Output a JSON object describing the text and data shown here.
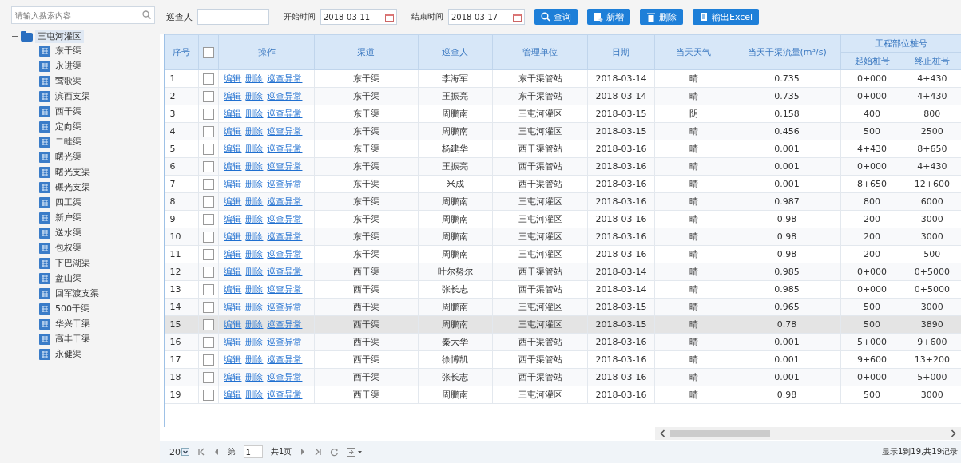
{
  "sidebar": {
    "search": {
      "placeholder": "请输入搜索内容"
    },
    "tree": {
      "label": "三屯河灌区",
      "expanded": true,
      "selected": true,
      "children": [
        {
          "label": "东干渠",
          "selected": false
        },
        {
          "label": "永进渠",
          "selected": false
        },
        {
          "label": "莺歌渠",
          "selected": false
        },
        {
          "label": "滨西支渠",
          "selected": false
        },
        {
          "label": "西干渠",
          "selected": false
        },
        {
          "label": "定向渠",
          "selected": false
        },
        {
          "label": "二畦渠",
          "selected": false
        },
        {
          "label": "曙光渠",
          "selected": false
        },
        {
          "label": "曙光支渠",
          "selected": false
        },
        {
          "label": "碾光支渠",
          "selected": false
        },
        {
          "label": "四工渠",
          "selected": false
        },
        {
          "label": "新户渠",
          "selected": false
        },
        {
          "label": "送水渠",
          "selected": false
        },
        {
          "label": "包权渠",
          "selected": false
        },
        {
          "label": "下巴湖渠",
          "selected": false
        },
        {
          "label": "盘山渠",
          "selected": false
        },
        {
          "label": "回军渡支渠",
          "selected": false
        },
        {
          "label": "500干渠",
          "selected": false
        },
        {
          "label": "华兴干渠",
          "selected": false
        },
        {
          "label": "高丰干渠",
          "selected": false
        },
        {
          "label": "永健渠",
          "selected": false
        }
      ]
    }
  },
  "toolbar": {
    "inspector_label": "巡查人",
    "start_label": "开始时间",
    "start_value": "2018-03-11",
    "end_label": "结束时间",
    "end_value": "2018-03-17",
    "buttons": [
      {
        "label": "查询",
        "kind": "search"
      },
      {
        "label": "新增",
        "kind": "add"
      },
      {
        "label": "删除",
        "kind": "delete"
      },
      {
        "label": "输出Excel",
        "kind": "export"
      }
    ]
  },
  "table": {
    "columns": {
      "seq": "序号",
      "ops": "操作",
      "channel": "渠道",
      "inspector": "巡查人",
      "unit": "管理单位",
      "date": "日期",
      "weather": "当天天气",
      "flow": "当天干渠流量(m³/s)",
      "stake_group": "工程部位桩号",
      "start": "起始桩号",
      "end": "终止桩号"
    },
    "select_all": false,
    "rows": [
      {
        "seq": "1",
        "checked": false,
        "selected": false,
        "ops": [
          "编辑",
          "删除",
          "巡查异常"
        ],
        "channel": "东干渠",
        "inspector": "李海军",
        "unit": "东干渠管站",
        "date": "2018-03-14",
        "weather": "晴",
        "flow": "0.735",
        "start": "0+000",
        "end": "4+430"
      },
      {
        "seq": "2",
        "checked": false,
        "selected": false,
        "ops": [
          "编辑",
          "删除",
          "巡查异常"
        ],
        "channel": "东干渠",
        "inspector": "王振亮",
        "unit": "东干渠管站",
        "date": "2018-03-14",
        "weather": "晴",
        "flow": "0.735",
        "start": "0+000",
        "end": "4+430"
      },
      {
        "seq": "3",
        "checked": false,
        "selected": false,
        "ops": [
          "编辑",
          "删除",
          "巡查异常"
        ],
        "channel": "东干渠",
        "inspector": "周鹏南",
        "unit": "三屯河灌区",
        "date": "2018-03-15",
        "weather": "阴",
        "flow": "0.158",
        "start": "400",
        "end": "800"
      },
      {
        "seq": "4",
        "checked": false,
        "selected": false,
        "ops": [
          "编辑",
          "删除",
          "巡查异常"
        ],
        "channel": "东干渠",
        "inspector": "周鹏南",
        "unit": "三屯河灌区",
        "date": "2018-03-15",
        "weather": "晴",
        "flow": "0.456",
        "start": "500",
        "end": "2500"
      },
      {
        "seq": "5",
        "checked": false,
        "selected": false,
        "ops": [
          "编辑",
          "删除",
          "巡查异常"
        ],
        "channel": "东干渠",
        "inspector": "杨建华",
        "unit": "西干渠管站",
        "date": "2018-03-16",
        "weather": "晴",
        "flow": "0.001",
        "start": "4+430",
        "end": "8+650"
      },
      {
        "seq": "6",
        "checked": false,
        "selected": false,
        "ops": [
          "编辑",
          "删除",
          "巡查异常"
        ],
        "channel": "东干渠",
        "inspector": "王振亮",
        "unit": "西干渠管站",
        "date": "2018-03-16",
        "weather": "晴",
        "flow": "0.001",
        "start": "0+000",
        "end": "4+430"
      },
      {
        "seq": "7",
        "checked": false,
        "selected": false,
        "ops": [
          "编辑",
          "删除",
          "巡查异常"
        ],
        "channel": "东干渠",
        "inspector": "米成",
        "unit": "西干渠管站",
        "date": "2018-03-16",
        "weather": "晴",
        "flow": "0.001",
        "start": "8+650",
        "end": "12+600"
      },
      {
        "seq": "8",
        "checked": false,
        "selected": false,
        "ops": [
          "编辑",
          "删除",
          "巡查异常"
        ],
        "channel": "东干渠",
        "inspector": "周鹏南",
        "unit": "三屯河灌区",
        "date": "2018-03-16",
        "weather": "晴",
        "flow": "0.987",
        "start": "800",
        "end": "6000"
      },
      {
        "seq": "9",
        "checked": false,
        "selected": false,
        "ops": [
          "编辑",
          "删除",
          "巡查异常"
        ],
        "channel": "东干渠",
        "inspector": "周鹏南",
        "unit": "三屯河灌区",
        "date": "2018-03-16",
        "weather": "晴",
        "flow": "0.98",
        "start": "200",
        "end": "3000"
      },
      {
        "seq": "10",
        "checked": false,
        "selected": false,
        "ops": [
          "编辑",
          "删除",
          "巡查异常"
        ],
        "channel": "东干渠",
        "inspector": "周鹏南",
        "unit": "三屯河灌区",
        "date": "2018-03-16",
        "weather": "晴",
        "flow": "0.98",
        "start": "200",
        "end": "3000"
      },
      {
        "seq": "11",
        "checked": false,
        "selected": false,
        "ops": [
          "编辑",
          "删除",
          "巡查异常"
        ],
        "channel": "东干渠",
        "inspector": "周鹏南",
        "unit": "三屯河灌区",
        "date": "2018-03-16",
        "weather": "晴",
        "flow": "0.98",
        "start": "200",
        "end": "500"
      },
      {
        "seq": "12",
        "checked": false,
        "selected": false,
        "ops": [
          "编辑",
          "删除",
          "巡查异常"
        ],
        "channel": "西干渠",
        "inspector": "叶尔努尔",
        "unit": "西干渠管站",
        "date": "2018-03-14",
        "weather": "晴",
        "flow": "0.985",
        "start": "0+000",
        "end": "0+5000"
      },
      {
        "seq": "13",
        "checked": false,
        "selected": false,
        "ops": [
          "编辑",
          "删除",
          "巡查异常"
        ],
        "channel": "西干渠",
        "inspector": "张长志",
        "unit": "西干渠管站",
        "date": "2018-03-14",
        "weather": "晴",
        "flow": "0.985",
        "start": "0+000",
        "end": "0+5000"
      },
      {
        "seq": "14",
        "checked": false,
        "selected": false,
        "ops": [
          "编辑",
          "删除",
          "巡查异常"
        ],
        "channel": "西干渠",
        "inspector": "周鹏南",
        "unit": "三屯河灌区",
        "date": "2018-03-15",
        "weather": "晴",
        "flow": "0.965",
        "start": "500",
        "end": "3000"
      },
      {
        "seq": "15",
        "checked": false,
        "selected": true,
        "ops": [
          "编辑",
          "删除",
          "巡查异常"
        ],
        "channel": "西干渠",
        "inspector": "周鹏南",
        "unit": "三屯河灌区",
        "date": "2018-03-15",
        "weather": "晴",
        "flow": "0.78",
        "start": "500",
        "end": "3890"
      },
      {
        "seq": "16",
        "checked": false,
        "selected": false,
        "ops": [
          "编辑",
          "删除",
          "巡查异常"
        ],
        "channel": "西干渠",
        "inspector": "秦大华",
        "unit": "西干渠管站",
        "date": "2018-03-16",
        "weather": "晴",
        "flow": "0.001",
        "start": "5+000",
        "end": "9+600"
      },
      {
        "seq": "17",
        "checked": false,
        "selected": false,
        "ops": [
          "编辑",
          "删除",
          "巡查异常"
        ],
        "channel": "西干渠",
        "inspector": "徐博凯",
        "unit": "西干渠管站",
        "date": "2018-03-16",
        "weather": "晴",
        "flow": "0.001",
        "start": "9+600",
        "end": "13+200"
      },
      {
        "seq": "18",
        "checked": false,
        "selected": false,
        "ops": [
          "编辑",
          "删除",
          "巡查异常"
        ],
        "channel": "西干渠",
        "inspector": "张长志",
        "unit": "西干渠管站",
        "date": "2018-03-16",
        "weather": "晴",
        "flow": "0.001",
        "start": "0+000",
        "end": "5+000"
      },
      {
        "seq": "19",
        "checked": false,
        "selected": false,
        "ops": [
          "编辑",
          "删除",
          "巡查异常"
        ],
        "channel": "西干渠",
        "inspector": "周鹏南",
        "unit": "三屯河灌区",
        "date": "2018-03-16",
        "weather": "晴",
        "flow": "0.98",
        "start": "500",
        "end": "3000"
      }
    ]
  },
  "pager": {
    "page_size": "20",
    "page_prefix": "第",
    "page": "1",
    "page_total": "共1页",
    "summary": "显示1到19,共19记录"
  }
}
